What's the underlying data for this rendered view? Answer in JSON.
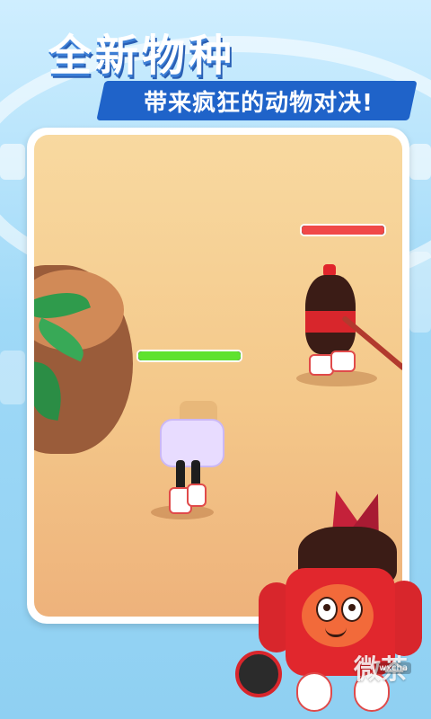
{
  "promo": {
    "title": "全新物种",
    "subtitle": "带来疯狂的动物对决!"
  },
  "arena": {
    "player": {
      "character": "toast-character",
      "health_fraction": 1.0,
      "health_color": "#5fe22e"
    },
    "enemy": {
      "character": "cola-bottle-character",
      "health_fraction": 1.0,
      "health_color": "#f04848"
    }
  },
  "mascot": {
    "character": "cola-robot-mascot"
  },
  "watermark": {
    "text": "微茶",
    "small_text": "wxcha"
  },
  "colors": {
    "accent": "#1f63c9",
    "arena_sand": "#f4c88a"
  }
}
